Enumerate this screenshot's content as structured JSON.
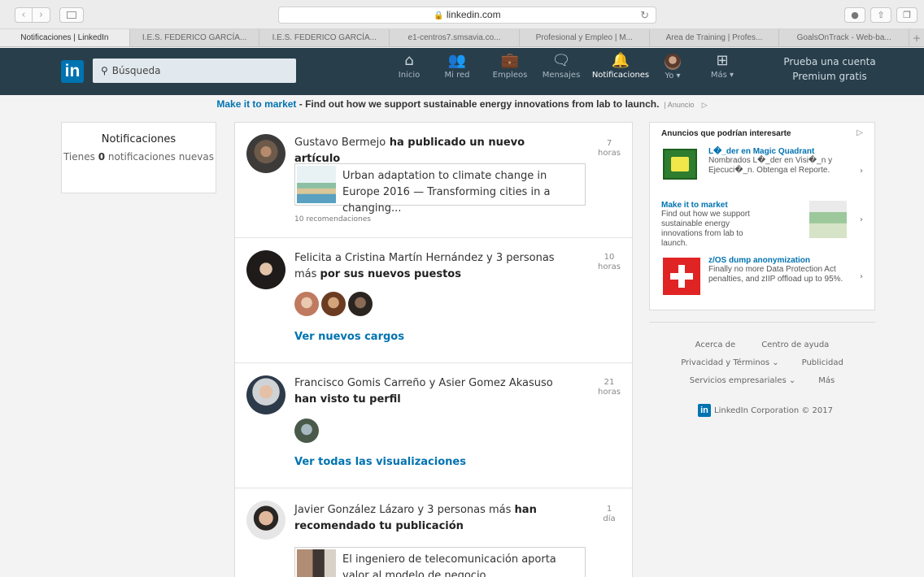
{
  "browser": {
    "url": "linkedin.com",
    "tabs": [
      "Notificaciones | LinkedIn",
      "I.E.S. FEDERICO GARCÍA...",
      "I.E.S. FEDERICO GARCÍA...",
      "e1-centros7.smsavia.co...",
      "Profesional y Empleo | M...",
      "Area de Training | Profes...",
      "GoalsOnTrack - Web-ba..."
    ]
  },
  "header": {
    "logo": "in",
    "search_placeholder": "Búsqueda",
    "nav": [
      {
        "label": "Inicio",
        "icon": "home-icon"
      },
      {
        "label": "Mi red",
        "icon": "network-icon"
      },
      {
        "label": "Empleos",
        "icon": "jobs-icon"
      },
      {
        "label": "Mensajes",
        "icon": "messages-icon"
      },
      {
        "label": "Notificaciones",
        "icon": "bell-icon"
      },
      {
        "label": "Yo ▾",
        "icon": "avatar"
      },
      {
        "label": "Más ▾",
        "icon": "grid-icon"
      }
    ],
    "premium_line1": "Prueba una cuenta",
    "premium_line2": "Premium gratis"
  },
  "top_ad": {
    "link": "Make it to market",
    "text": " - Find out how we support sustainable energy innovations from lab to launch.",
    "label": "| Anuncio"
  },
  "left_card": {
    "title": "Notificaciones",
    "prefix": "Tienes ",
    "count": "0",
    "suffix": " notificaciones nuevas"
  },
  "notifications": [
    {
      "name": "Gustavo Bermejo",
      "action": " ha publicado un nuevo artículo",
      "time_value": "7",
      "time_unit": "horas",
      "article_title": "Urban adaptation to climate change in Europe 2016 — Transforming cities in a changing...",
      "recommendations": "10 recomendaciones"
    },
    {
      "text": "Felicita a Cristina Martín Hernández y 3 personas más ",
      "bold": "por sus nuevos puestos",
      "time_value": "10",
      "time_unit": "horas",
      "link": "Ver nuevos cargos"
    },
    {
      "text": "Francisco Gomis Carreño y Asier Gomez Akasuso ",
      "bold": "han visto tu perfil",
      "time_value": "21",
      "time_unit": "horas",
      "link": "Ver todas las visualizaciones"
    },
    {
      "text": "Javier González Lázaro y 3 personas más ",
      "bold": "han recomendado tu publicación",
      "time_value": "1",
      "time_unit": "día",
      "article_title": "El ingeniero de telecomunicación aporta valor al modelo de negocio"
    }
  ],
  "ads": {
    "title": "Anuncios que podrían interesarte",
    "items": [
      {
        "name": "L�_der en Magic Quadrant",
        "desc": "Nombrados L�_der en Visi�_n y Ejecuci�_n. Obtenga el Reporte."
      },
      {
        "name": "Make it to market",
        "desc": "Find out how we support sustainable energy innovations from lab to launch."
      },
      {
        "name": "z/OS dump anonymization",
        "desc": "Finally no more Data Protection Act penalties, and zIIP offload up to 95%."
      }
    ]
  },
  "footer": {
    "about": "Acerca de",
    "help": "Centro de ayuda",
    "privacy": "Privacidad y Términos ⌄",
    "ads": "Publicidad",
    "business": "Servicios empresariales ⌄",
    "more": "Más",
    "corp": "LinkedIn Corporation © 2017"
  },
  "colors": {
    "brand": "#0073b1",
    "header_bg": "#283e4a",
    "page_bg": "#f3f3f3"
  }
}
